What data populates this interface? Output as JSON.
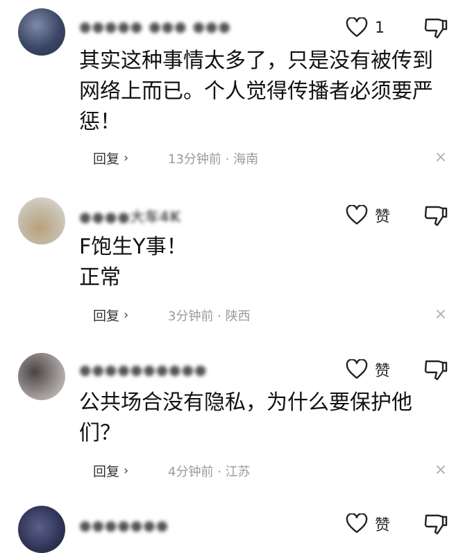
{
  "comments": [
    {
      "username": "●●●●● ●●● ●●●",
      "text_lines": [
        "其实这种事情太多了，只是没有被传到",
        "网络上而已。个人觉得传播者必须要严",
        "惩！"
      ],
      "like_count": "1",
      "reply_label": "回复",
      "meta": "13分钟前 · 海南"
    },
    {
      "username": "●●●●大车4K",
      "text_lines": [
        "F饱生Y事！",
        "正常"
      ],
      "like_count": "赞",
      "reply_label": "回复",
      "meta": "3分钟前 · 陕西"
    },
    {
      "username": "●●●●●●●●●●",
      "text_lines": [
        "公共场合没有隐私，为什么要保护他",
        "们？"
      ],
      "like_count": "赞",
      "reply_label": "回复",
      "meta": "4分钟前 · 江苏"
    },
    {
      "username": "●●●●●●●",
      "text_lines": [],
      "like_count": "赞",
      "reply_label": "",
      "meta": ""
    }
  ],
  "icons": {
    "like": "heart-outline-icon",
    "dislike": "thumbs-down-outline-icon",
    "reply_chevron": "chevron-right-icon",
    "close": "close-icon"
  }
}
